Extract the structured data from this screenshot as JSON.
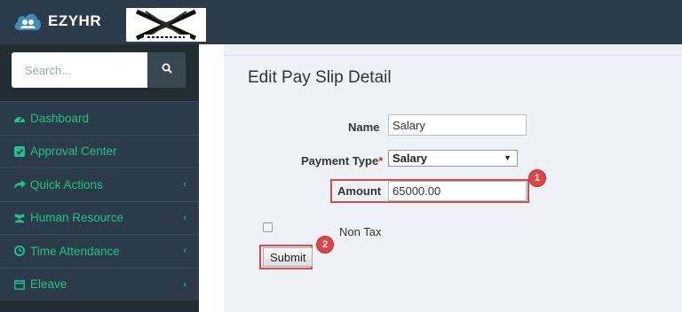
{
  "header": {
    "app_name": "EZYHR",
    "brand_image": "monsta-x-logo"
  },
  "sidebar": {
    "search_placeholder": "Search...",
    "items": [
      {
        "label": "Dashboard",
        "icon": "dashboard-icon",
        "has_children": false
      },
      {
        "label": "Approval Center",
        "icon": "check-square-icon",
        "has_children": false
      },
      {
        "label": "Quick Actions",
        "icon": "share-arrow-icon",
        "has_children": true
      },
      {
        "label": "Human Resource",
        "icon": "users-icon",
        "has_children": true
      },
      {
        "label": "Time Attendance",
        "icon": "clock-icon",
        "has_children": true
      },
      {
        "label": "Eleave",
        "icon": "calendar-icon",
        "has_children": true
      }
    ]
  },
  "page": {
    "title": "Edit Pay Slip Detail",
    "form": {
      "name_label": "Name",
      "name_value": "Salary",
      "payment_type_label": "Payment Type",
      "payment_type_required_mark": "*",
      "payment_type_value": "Salary",
      "amount_label": "Amount",
      "amount_value": "65000.00",
      "non_tax_label": "Non Tax",
      "non_tax_checked": false,
      "submit_label": "Submit"
    },
    "annotations": {
      "amount_badge": "1",
      "submit_badge": "2"
    }
  },
  "colors": {
    "sidebar_bg": "#2c3b4a",
    "menu_text": "#1ec28b",
    "highlight": "#d94b4b",
    "content_bg": "#eef1f6"
  }
}
